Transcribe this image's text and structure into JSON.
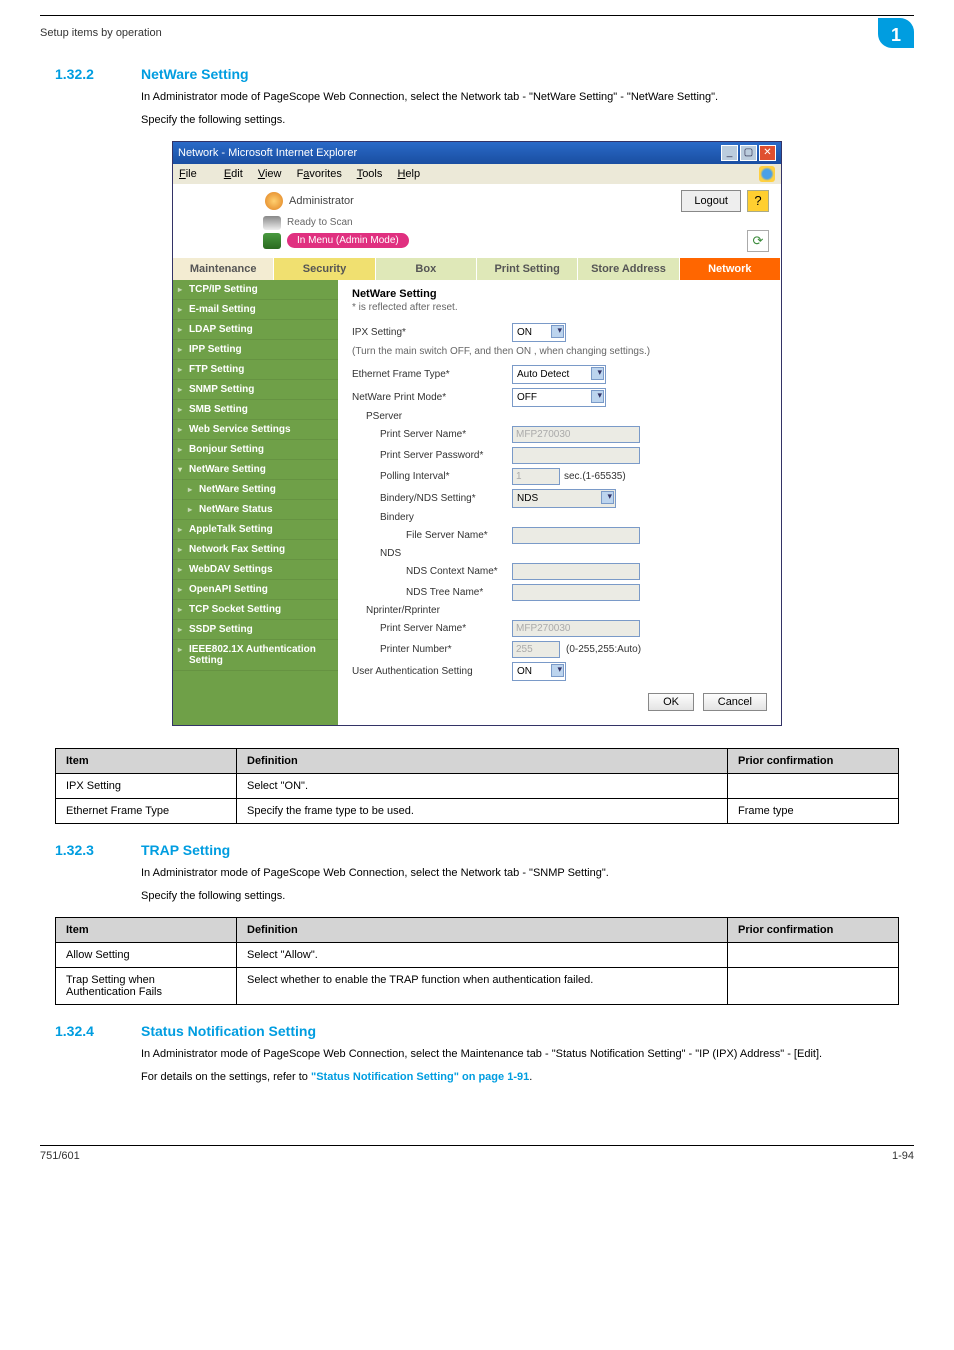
{
  "header": {
    "left": "Setup items by operation",
    "badge": "1"
  },
  "sec1": {
    "num": "1.32.2",
    "title": "NetWare Setting",
    "p1": "In Administrator mode of PageScope Web Connection, select the Network tab - \"NetWare Setting\" - \"NetWare Setting\".",
    "p2": "Specify the following settings."
  },
  "browser": {
    "title": "Network - Microsoft Internet Explorer",
    "menu": {
      "file": "File",
      "edit": "Edit",
      "view": "View",
      "fav": "Favorites",
      "tools": "Tools",
      "help": "Help"
    },
    "admin": "Administrator",
    "logout": "Logout",
    "help": "?",
    "ready": "Ready to Scan",
    "mode": "In Menu (Admin Mode)",
    "refresh": "⟳",
    "tabs": {
      "maint": "Maintenance",
      "sec": "Security",
      "box": "Box",
      "print": "Print Setting",
      "store": "Store Address",
      "net": "Network"
    },
    "side": {
      "tcpip": "TCP/IP Setting",
      "email": "E-mail Setting",
      "ldap": "LDAP Setting",
      "ipp": "IPP Setting",
      "ftp": "FTP Setting",
      "snmp": "SNMP Setting",
      "smb": "SMB Setting",
      "webservice": "Web Service Settings",
      "bonjour": "Bonjour Setting",
      "netware": "NetWare Setting",
      "netware_setting": "NetWare Setting",
      "netware_status": "NetWare Status",
      "appletalk": "AppleTalk Setting",
      "netfax": "Network Fax Setting",
      "webdav": "WebDAV Settings",
      "openapi": "OpenAPI Setting",
      "tcpsocket": "TCP Socket Setting",
      "ssdp": "SSDP Setting",
      "ieee": "IEEE802.1X Authentication Setting"
    },
    "panel": {
      "title": "NetWare Setting",
      "note": "* is reflected after reset.",
      "ipx": "IPX Setting*",
      "ipx_val": "ON",
      "ipx_hint": "(Turn the main switch OFF, and then ON , when changing settings.)",
      "frame": "Ethernet Frame Type*",
      "frame_val": "Auto Detect",
      "mode": "NetWare Print Mode*",
      "mode_val": "OFF",
      "pserver": "PServer",
      "psn": "Print Server Name*",
      "psn_val": "MFP270030",
      "psp": "Print Server Password*",
      "poll": "Polling Interval*",
      "poll_val": "1",
      "poll_unit": "sec.(1-65535)",
      "bind": "Bindery/NDS Setting*",
      "bind_val": "NDS",
      "bindery": "Bindery",
      "fsn": "File Server Name*",
      "nds": "NDS",
      "ndscn": "NDS Context Name*",
      "ndstn": "NDS Tree Name*",
      "nprinter": "Nprinter/Rprinter",
      "npsn": "Print Server Name*",
      "npsn_val": "MFP270030",
      "pnum": "Printer Number*",
      "pnum_val": "255",
      "pnum_hint": "(0-255,255:Auto)",
      "uauth": "User Authentication Setting",
      "uauth_val": "ON",
      "ok": "OK",
      "cancel": "Cancel"
    }
  },
  "table1": {
    "h1": "Item",
    "h2": "Definition",
    "h3": "Prior confirmation",
    "r1c1": "IPX Setting",
    "r1c2": "Select \"ON\".",
    "r1c3": "",
    "r2c1": "Ethernet Frame Type",
    "r2c2": "Specify the frame type to be used.",
    "r2c3": "Frame type"
  },
  "sec2": {
    "num": "1.32.3",
    "title": "TRAP Setting",
    "p1": "In Administrator mode of PageScope Web Connection, select the Network tab - \"SNMP Setting\".",
    "p2": "Specify the following settings."
  },
  "table2": {
    "h1": "Item",
    "h2": "Definition",
    "h3": "Prior confirmation",
    "r1c1": "Allow Setting",
    "r1c2": "Select \"Allow\".",
    "r1c3": "",
    "r2c1": "Trap Setting when Authentication Fails",
    "r2c2": "Select whether to enable the TRAP function when authentication failed.",
    "r2c3": ""
  },
  "sec3": {
    "num": "1.32.4",
    "title": "Status Notification Setting",
    "p1": "In Administrator mode of PageScope Web Connection, select the Maintenance tab - \"Status Notification Setting\" - \"IP (IPX) Address\" - [Edit].",
    "p2a": "For details on the settings, refer to ",
    "p2link": "\"Status Notification Setting\" on page 1-91",
    "p2b": "."
  },
  "footer": {
    "left": "751/601",
    "right": "1-94"
  }
}
